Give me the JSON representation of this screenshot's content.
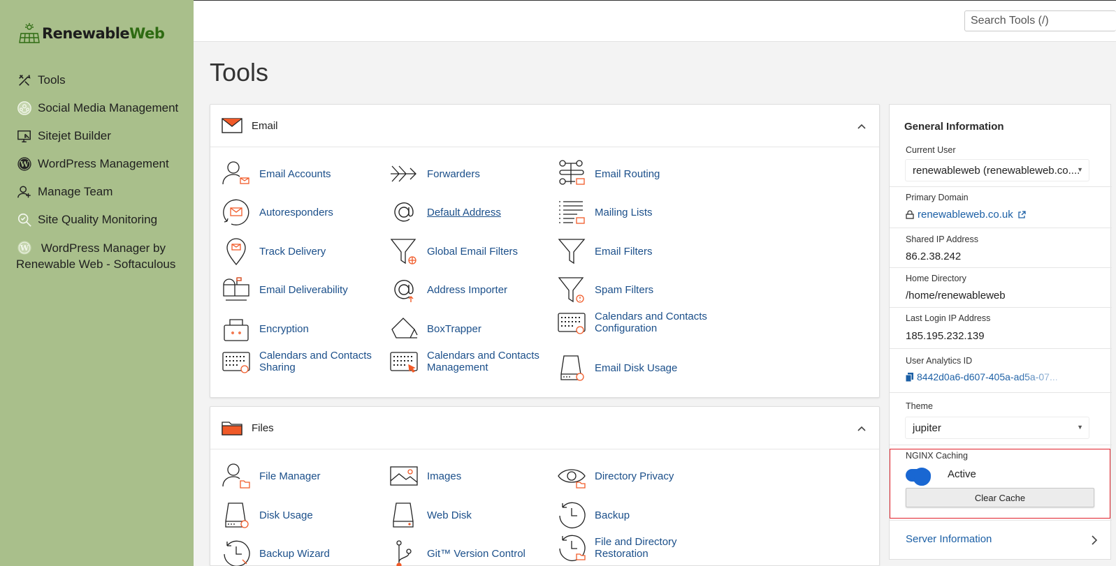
{
  "brand": {
    "name_part1": "Renewable",
    "name_part2": "Web"
  },
  "sidebar": {
    "items": [
      {
        "label": "Tools",
        "icon": "tools-icon"
      },
      {
        "label": "Social Media Management",
        "icon": "social-media-icon"
      },
      {
        "label": "Sitejet Builder",
        "icon": "sitejet-icon"
      },
      {
        "label": "WordPress Management",
        "icon": "wordpress-icon"
      },
      {
        "label": "Manage Team",
        "icon": "team-icon"
      },
      {
        "label": "Site Quality Monitoring",
        "icon": "quality-monitor-icon"
      },
      {
        "label": "WordPress Manager by Renewable Web - Softaculous",
        "icon": "wordpress-icon"
      }
    ]
  },
  "search": {
    "placeholder": "Search Tools (/)"
  },
  "page": {
    "title": "Tools"
  },
  "email": {
    "title": "Email",
    "tools": [
      "Email Accounts",
      "Forwarders",
      "Email Routing",
      "Autoresponders",
      "Default Address",
      "Mailing Lists",
      "Track Delivery",
      "Global Email Filters",
      "Email Filters",
      "Email Deliverability",
      "Address Importer",
      "Spam Filters",
      "Encryption",
      "BoxTrapper",
      "Calendars and Contacts Configuration",
      "Calendars and Contacts Sharing",
      "Calendars and Contacts Management",
      "Email Disk Usage"
    ]
  },
  "files": {
    "title": "Files",
    "tools": [
      "File Manager",
      "Images",
      "Directory Privacy",
      "Disk Usage",
      "Web Disk",
      "Backup",
      "Backup Wizard",
      "Git™ Version Control",
      "File and Directory Restoration"
    ]
  },
  "info": {
    "title": "General Information",
    "current_user_label": "Current User",
    "current_user_value": "renewableweb (renewableweb.co....",
    "primary_domain_label": "Primary Domain",
    "primary_domain_value": "renewableweb.co.uk",
    "shared_ip_label": "Shared IP Address",
    "shared_ip_value": "86.2.38.242",
    "home_dir_label": "Home Directory",
    "home_dir_value": "/home/renewableweb",
    "last_login_label": "Last Login IP Address",
    "last_login_value": "185.195.232.139",
    "analytics_label": "User Analytics ID",
    "analytics_value": "8442d0a6-d607-405a-ad5a-07...",
    "theme_label": "Theme",
    "theme_value": "jupiter",
    "nginx_label": "NGINX Caching",
    "nginx_status": "Active",
    "clear_cache_label": "Clear Cache",
    "server_info_label": "Server Information"
  }
}
